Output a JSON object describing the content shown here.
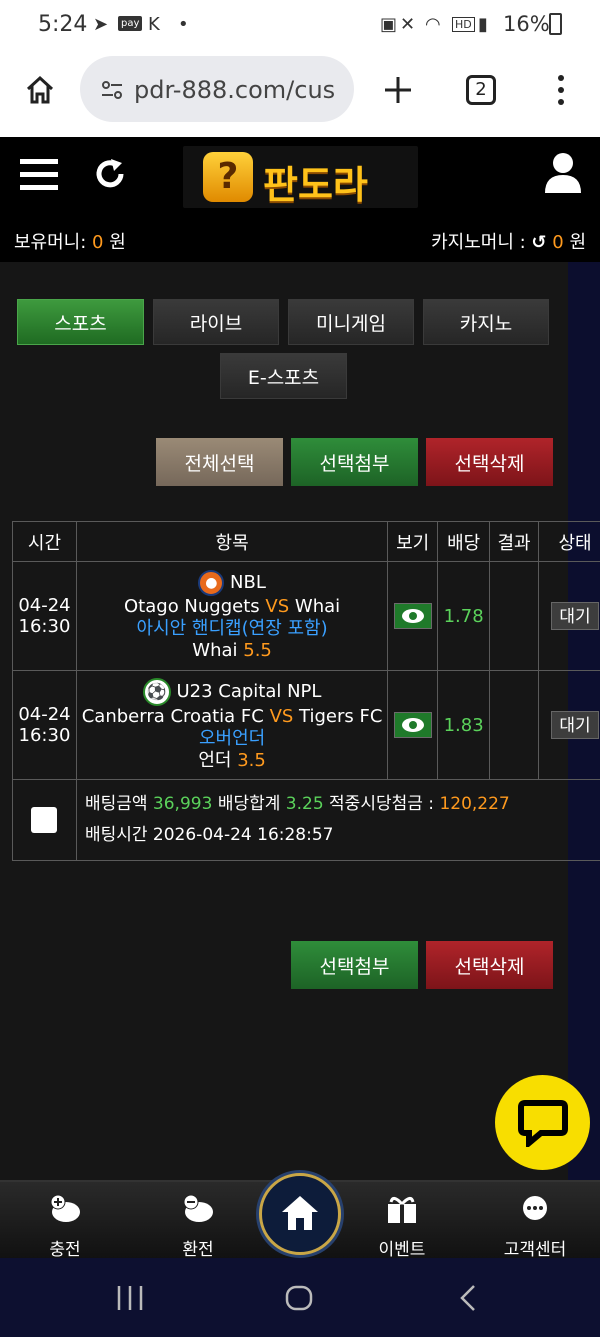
{
  "statusbar": {
    "time": "5:24",
    "battery": "16%"
  },
  "browser": {
    "url": "pdr-888.com/cus",
    "tab_count": "2"
  },
  "header": {
    "logo_text": "판도라"
  },
  "money": {
    "holding_label": "보유머니:",
    "holding_value": "0",
    "holding_unit": "원",
    "casino_label": "카지노머니 :",
    "casino_value": "0",
    "casino_unit": "원"
  },
  "tabs": {
    "sports": "스포츠",
    "live": "라이브",
    "minigame": "미니게임",
    "casino": "카지노",
    "esports": "E-스포츠"
  },
  "actions": {
    "select_all": "전체선택",
    "attach": "선택첨부",
    "delete": "선택삭제"
  },
  "table": {
    "headers": [
      "시간",
      "항목",
      "보기",
      "배당",
      "결과",
      "상태"
    ],
    "rows": [
      {
        "date": "04-24",
        "time": "16:30",
        "league": "NBL",
        "home": "Otago Nuggets",
        "vs": "VS",
        "away": "Whai",
        "market": "아시안 핸디캡(연장 포함)",
        "pick": "Whai",
        "pick_value": "5.5",
        "odds": "1.78",
        "status": "대기"
      },
      {
        "date": "04-24",
        "time": "16:30",
        "league": "U23 Capital NPL",
        "home": "Canberra Croatia FC",
        "vs": "VS",
        "away": "Tigers FC",
        "market": "오버언더",
        "pick": "언더",
        "pick_value": "3.5",
        "odds": "1.83",
        "status": "대기"
      }
    ],
    "summary": {
      "bet_amount_label": "배팅금액",
      "bet_amount": "36,993",
      "odds_total_label": "배당합계",
      "odds_total": "3.25",
      "payout_label": "적중시당첨금 :",
      "payout": "120,227",
      "bet_time_label": "배팅시간",
      "bet_time": "2026-04-24 16:28:57"
    }
  },
  "bottom_actions": {
    "attach": "선택첨부",
    "delete": "선택삭제"
  },
  "nav": {
    "charge": "충전",
    "exchange": "환전",
    "event": "이벤트",
    "support": "고객센터"
  },
  "colors": {
    "accent_green": "#1d6326",
    "accent_red": "#7d1419",
    "orange": "#ff9a1e",
    "blue": "#3aa0ff",
    "chat": "#f8de00"
  }
}
